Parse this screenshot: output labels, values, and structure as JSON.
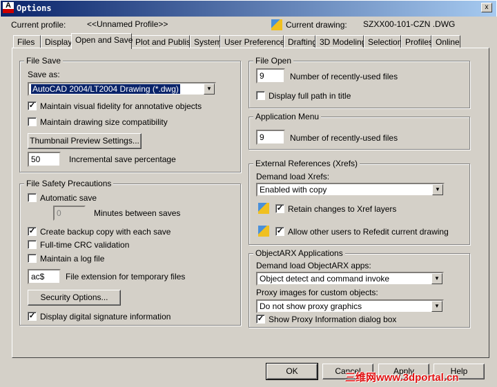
{
  "window": {
    "title": "Options",
    "close": "x",
    "icon_letter": "A"
  },
  "header": {
    "profile_label": "Current profile:",
    "profile_value": "<<Unnamed Profile>>",
    "drawing_label": "Current drawing:",
    "drawing_value": "SZXX00-101-CZN .DWG"
  },
  "tabs": [
    "Files",
    "Display",
    "Open and Save",
    "Plot and Publish",
    "System",
    "User Preferences",
    "Drafting",
    "3D Modeling",
    "Selection",
    "Profiles",
    "Online"
  ],
  "active_tab": "Open and Save",
  "file_save": {
    "title": "File Save",
    "save_as_label": "Save as:",
    "save_as_value": "AutoCAD 2004/LT2004 Drawing (*.dwg)",
    "fidelity": "Maintain visual fidelity for annotative objects",
    "fidelity_checked": true,
    "size_compat": "Maintain drawing size compatibility",
    "size_compat_checked": false,
    "thumbnail_button": "Thumbnail Preview Settings...",
    "incremental_value": "50",
    "incremental_label": "Incremental save percentage"
  },
  "file_safety": {
    "title": "File Safety Precautions",
    "autosave": "Automatic save",
    "autosave_checked": false,
    "minutes_value": "0",
    "minutes_label": "Minutes between saves",
    "backup": "Create backup copy with each save",
    "backup_checked": true,
    "crc": "Full-time CRC validation",
    "crc_checked": false,
    "log": "Maintain a log file",
    "log_checked": false,
    "ext_value": "ac$",
    "ext_label": "File extension for temporary files",
    "security_button": "Security Options...",
    "signature": "Display digital signature information",
    "signature_checked": true
  },
  "file_open": {
    "title": "File Open",
    "recent_value": "9",
    "recent_label": "Number of recently-used files",
    "fullpath": "Display full path in title",
    "fullpath_checked": false
  },
  "app_menu": {
    "title": "Application Menu",
    "recent_value": "9",
    "recent_label": "Number of recently-used files"
  },
  "xrefs": {
    "title": "External References (Xrefs)",
    "demand_label": "Demand load Xrefs:",
    "demand_value": "Enabled with copy",
    "retain": "Retain changes to Xref layers",
    "retain_checked": true,
    "refedit": "Allow other users to Refedit current drawing",
    "refedit_checked": true
  },
  "objectarx": {
    "title": "ObjectARX Applications",
    "demand_label": "Demand load ObjectARX apps:",
    "demand_value": "Object detect and command invoke",
    "proxy_label": "Proxy images for custom objects:",
    "proxy_value": "Do not show proxy graphics",
    "show_proxy": "Show Proxy Information dialog box",
    "show_proxy_checked": true
  },
  "buttons": {
    "ok": "OK",
    "cancel": "Cancel",
    "apply": "Apply",
    "help": "Help"
  },
  "watermark": "三维网www.3dportal.cn"
}
